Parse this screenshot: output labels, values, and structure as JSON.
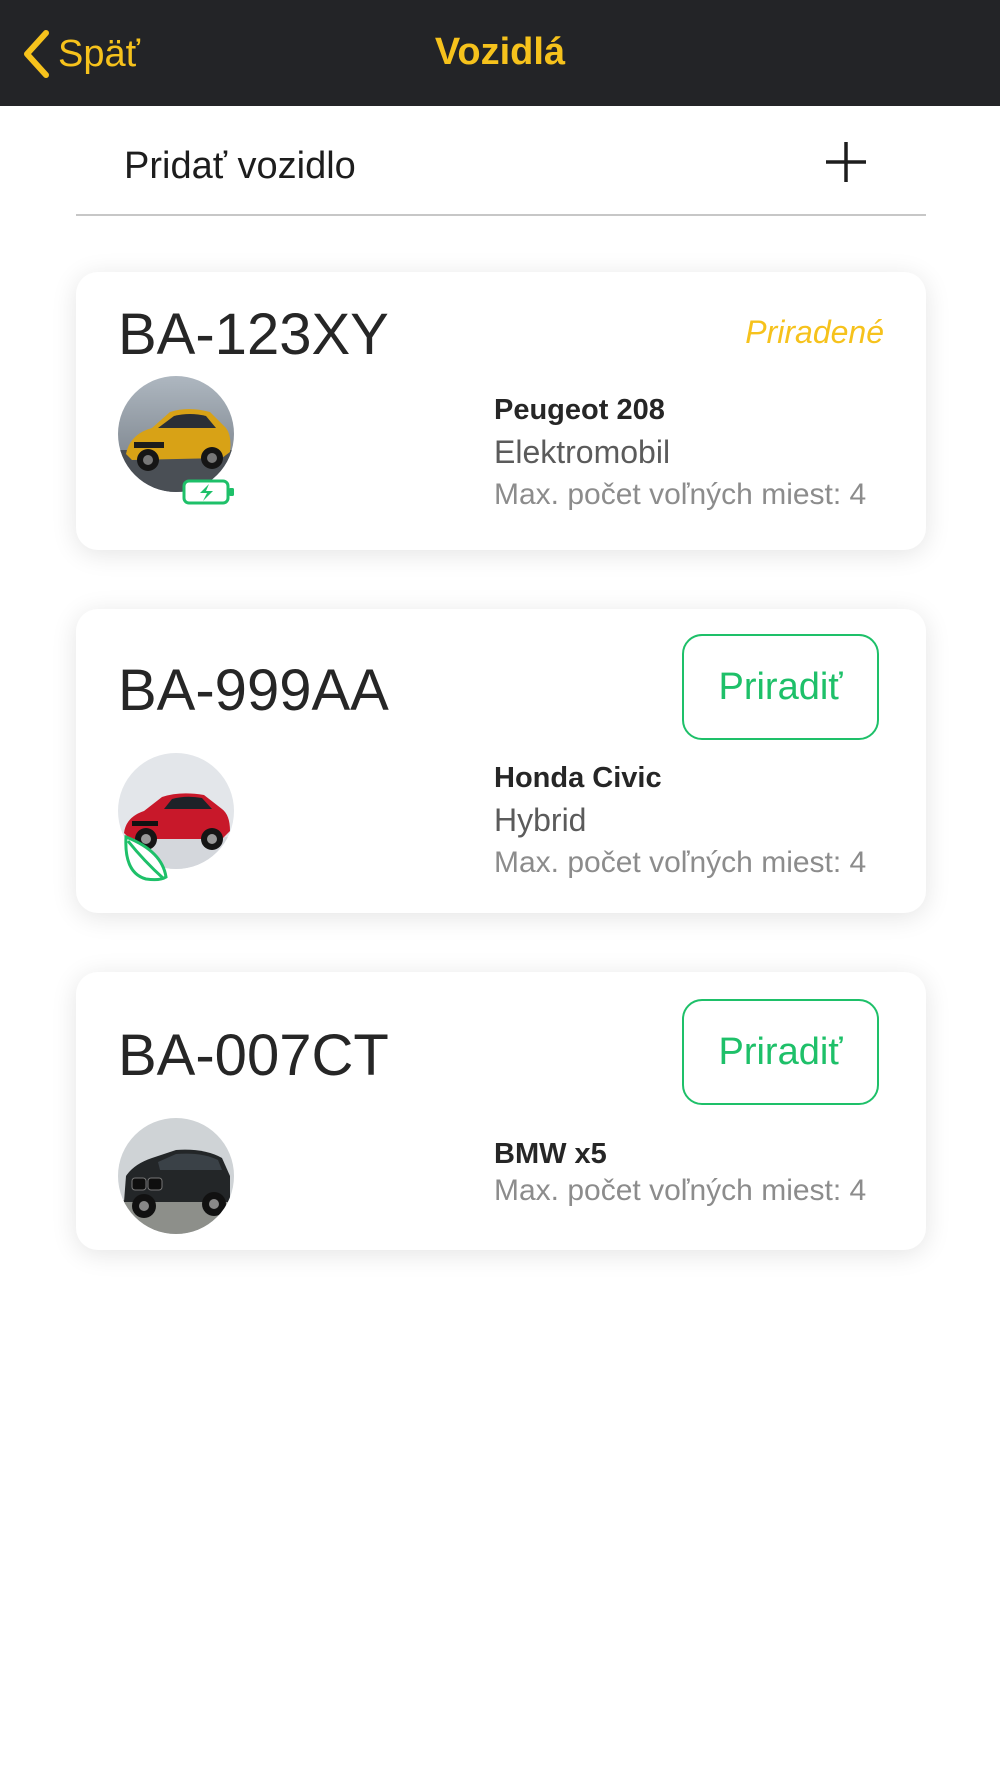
{
  "header": {
    "back_label": "Späť",
    "title": "Vozidlá"
  },
  "add_vehicle": {
    "label": "Pridať vozidlo"
  },
  "vehicles": [
    {
      "plate": "BA-123XY",
      "status": "Priradené",
      "model": "Peugeot 208",
      "fuel_type": "Elektromobil",
      "seats_text": "Max. počet voľných miest: 4",
      "badge_icon": "battery-charging-icon"
    },
    {
      "plate": "BA-999AA",
      "action_label": "Priradiť",
      "model": "Honda Civic",
      "fuel_type": "Hybrid",
      "seats_text": "Max. počet voľných miest: 4",
      "badge_icon": "leaf-icon"
    },
    {
      "plate": "BA-007CT",
      "action_label": "Priradiť",
      "model": "BMW x5",
      "seats_text": "Max. počet voľných miest: 4"
    }
  ],
  "colors": {
    "accent": "#f6c21c",
    "header_bg": "#232427",
    "green": "#1ec069"
  }
}
